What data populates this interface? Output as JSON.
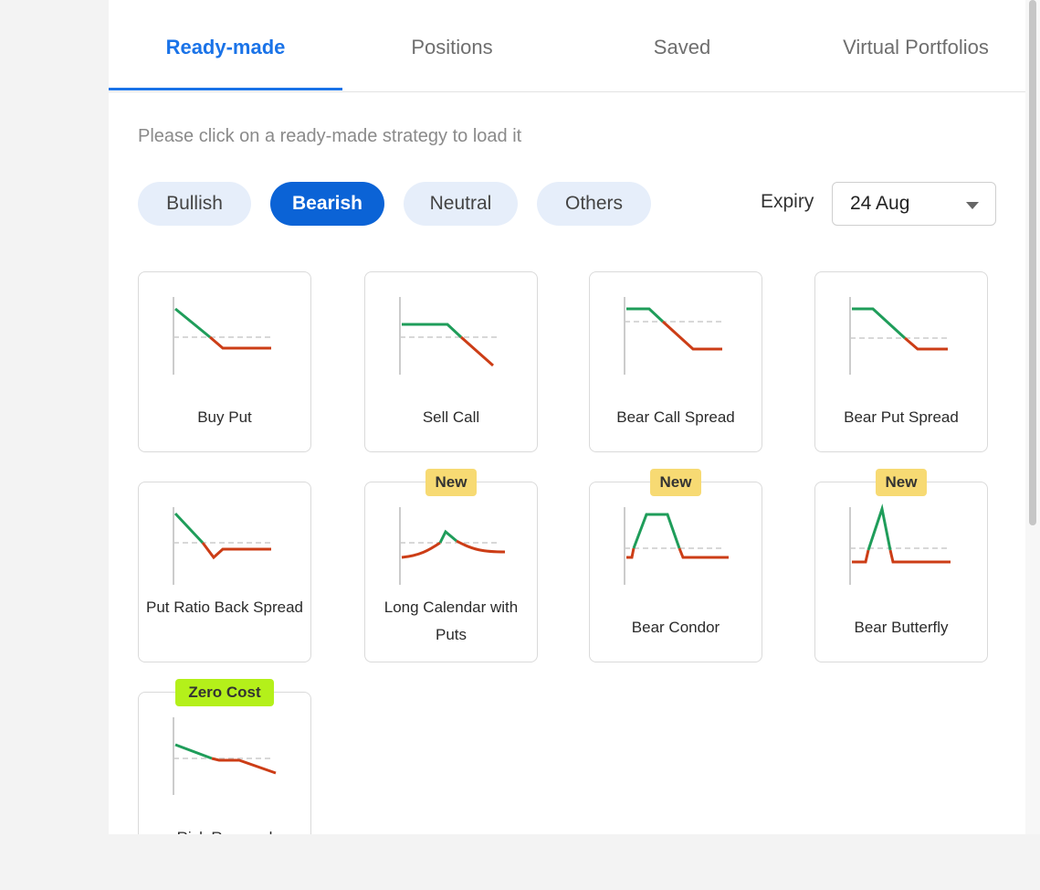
{
  "tabs": [
    {
      "label": "Ready-made",
      "active": true
    },
    {
      "label": "Positions",
      "active": false
    },
    {
      "label": "Saved",
      "active": false
    },
    {
      "label": "Virtual Portfolios",
      "active": false
    }
  ],
  "hint": "Please click on a ready-made strategy to load it",
  "filters": [
    {
      "label": "Bullish",
      "active": false
    },
    {
      "label": "Bearish",
      "active": true
    },
    {
      "label": "Neutral",
      "active": false
    },
    {
      "label": "Others",
      "active": false
    }
  ],
  "expiry": {
    "label": "Expiry",
    "value": "24 Aug"
  },
  "strategies": [
    {
      "name": "Buy Put",
      "badge": "",
      "payoff_icon": "buy-put-payoff-icon"
    },
    {
      "name": "Sell Call",
      "badge": "",
      "payoff_icon": "sell-call-payoff-icon"
    },
    {
      "name": "Bear Call Spread",
      "badge": "",
      "payoff_icon": "bear-call-spread-payoff-icon"
    },
    {
      "name": "Bear Put Spread",
      "badge": "",
      "payoff_icon": "bear-put-spread-payoff-icon"
    },
    {
      "name": "Put Ratio Back Spread",
      "badge": "",
      "payoff_icon": "put-ratio-back-spread-payoff-icon"
    },
    {
      "name": "Long Calendar with Puts",
      "badge": "New",
      "payoff_icon": "long-calendar-payoff-icon"
    },
    {
      "name": "Bear Condor",
      "badge": "New",
      "payoff_icon": "bear-condor-payoff-icon"
    },
    {
      "name": "Bear Butterfly",
      "badge": "New",
      "payoff_icon": "bear-butterfly-payoff-icon"
    },
    {
      "name": "Risk Reversal",
      "badge": "Zero Cost",
      "payoff_icon": "risk-reversal-payoff-icon"
    }
  ],
  "colors": {
    "accent": "#1a73e8",
    "active_pill": "#0b63d6",
    "profit": "#1f9d5a",
    "loss": "#cc3d16",
    "new_badge": "#f7da73",
    "zero_cost_badge": "#b4f01a"
  }
}
